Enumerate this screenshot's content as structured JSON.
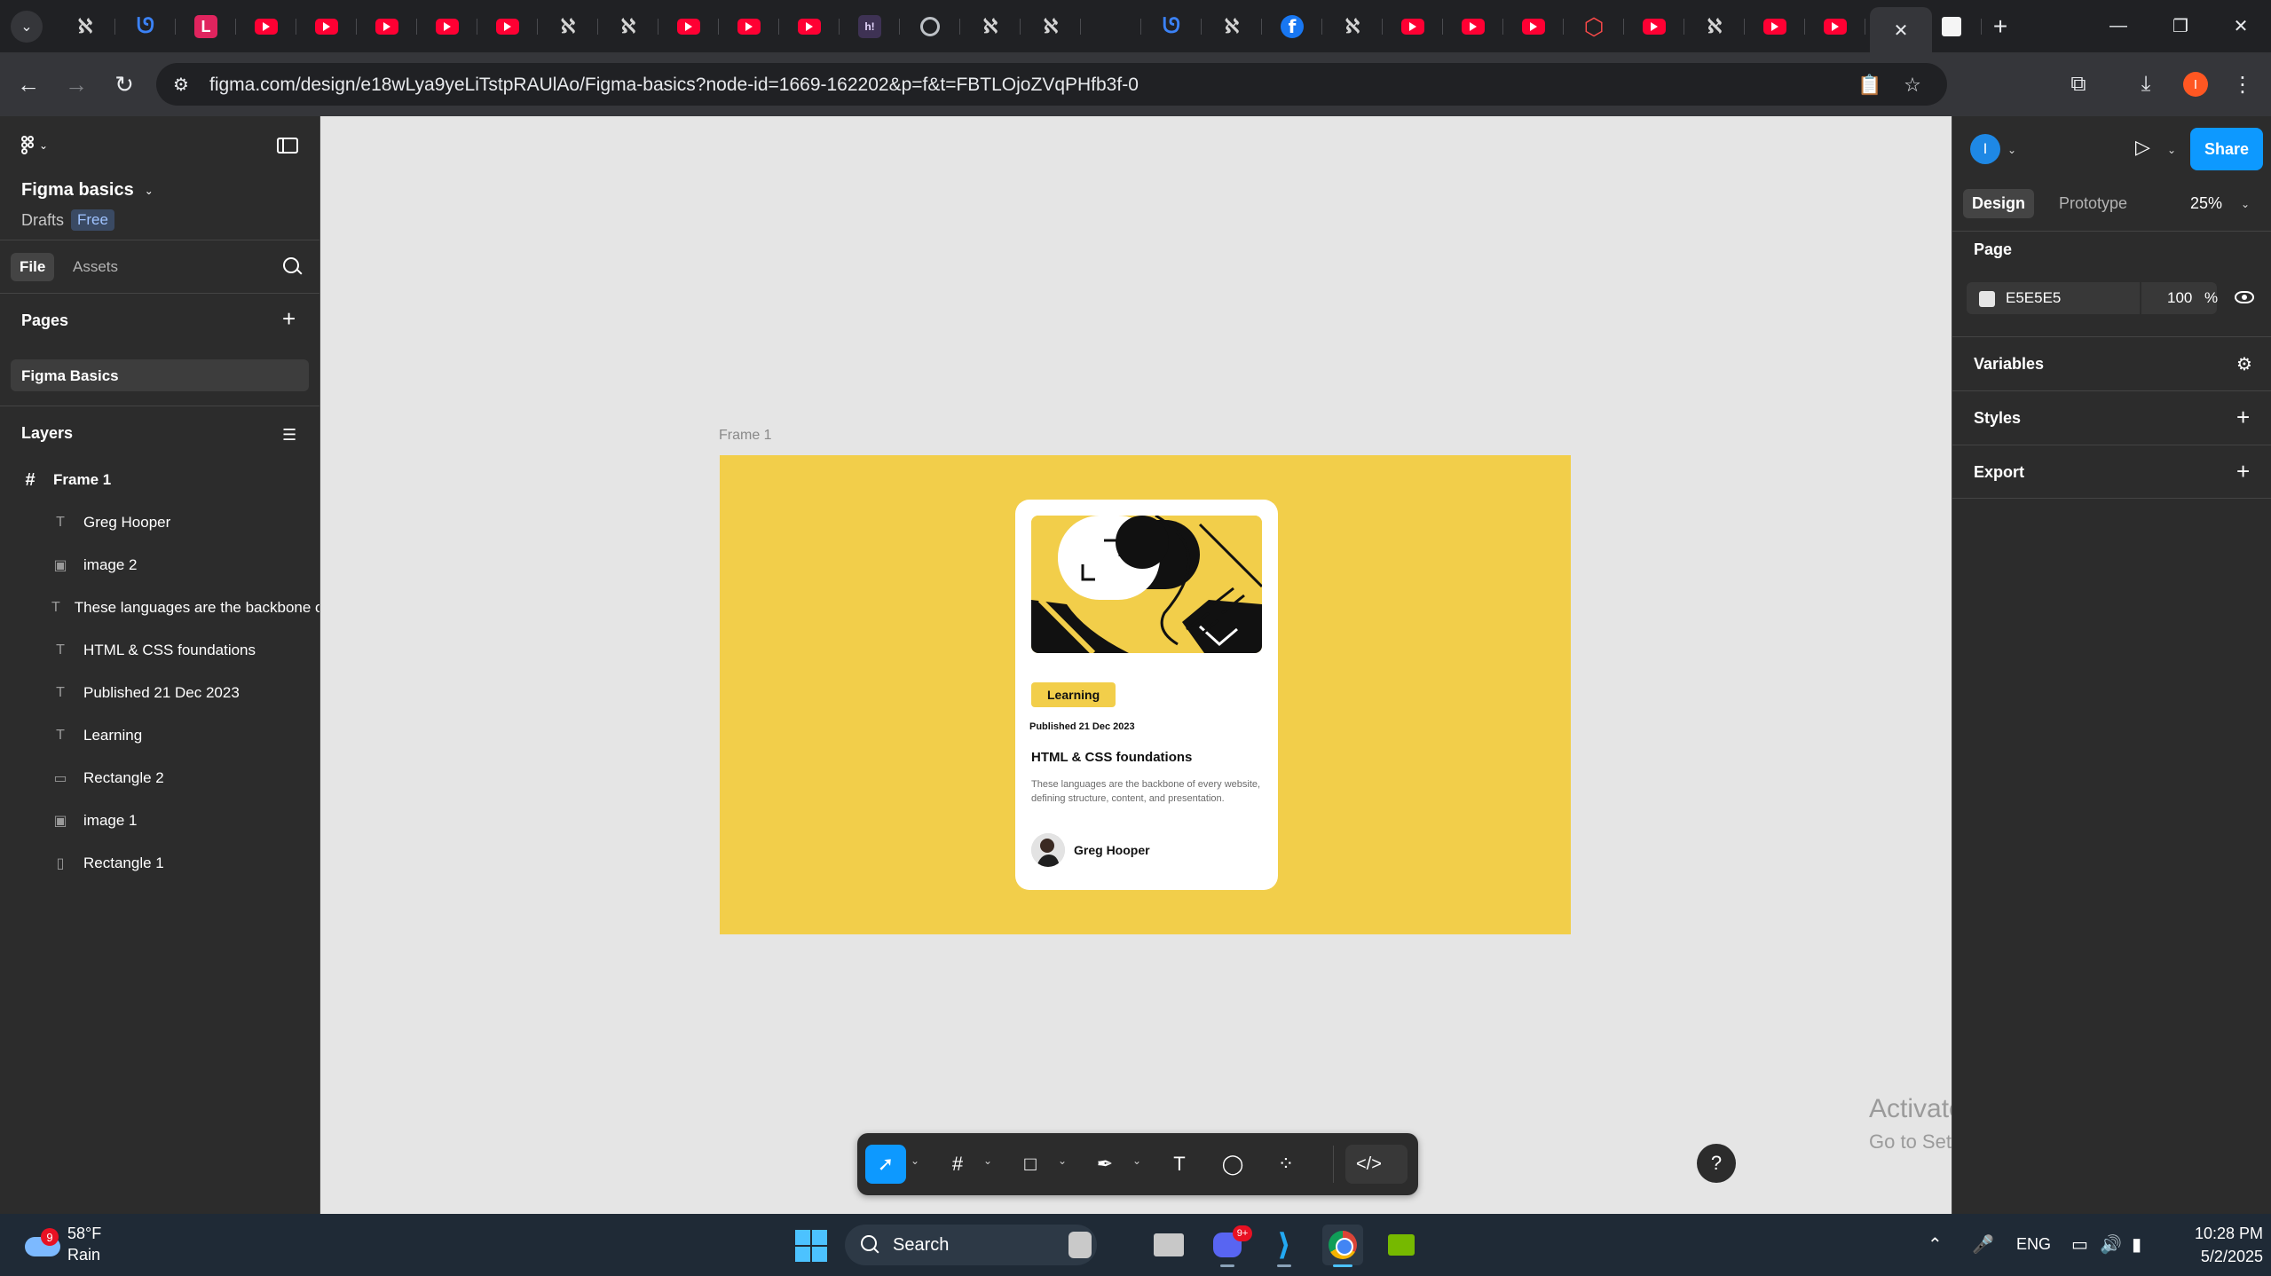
{
  "browser": {
    "url": "figma.com/design/e18wLya9yeLiTstpRAUlAo/Figma-basics?node-id=1669-162202&p=f&t=FBTLOjoZVqPHfb3f-0",
    "profile_initial": "I",
    "tabs": [
      {
        "icon": "lc-icon",
        "glyph": "ℵ"
      },
      {
        "icon": "blue-app-icon",
        "glyph": "ᘎ"
      },
      {
        "icon": "red-l-icon",
        "glyph": "L"
      },
      {
        "icon": "youtube-icon",
        "glyph": ""
      },
      {
        "icon": "youtube-icon",
        "glyph": ""
      },
      {
        "icon": "youtube-icon",
        "glyph": ""
      },
      {
        "icon": "youtube-icon",
        "glyph": ""
      },
      {
        "icon": "youtube-icon",
        "glyph": ""
      },
      {
        "icon": "lc-icon",
        "glyph": "ℵ"
      },
      {
        "icon": "lc-icon",
        "glyph": "ℵ"
      },
      {
        "icon": "youtube-icon",
        "glyph": ""
      },
      {
        "icon": "youtube-icon",
        "glyph": ""
      },
      {
        "icon": "youtube-icon",
        "glyph": ""
      },
      {
        "icon": "hackerrank-icon",
        "glyph": "h!"
      },
      {
        "icon": "globe-icon",
        "glyph": ""
      },
      {
        "icon": "lc-icon",
        "glyph": "ℵ"
      },
      {
        "icon": "lc-icon",
        "glyph": "ℵ"
      },
      {
        "icon": "blank-icon",
        "glyph": ""
      },
      {
        "icon": "blue-app-icon",
        "glyph": "ᘎ"
      },
      {
        "icon": "lc-icon",
        "glyph": "ℵ"
      },
      {
        "icon": "facebook-icon",
        "glyph": "f"
      },
      {
        "icon": "lc-icon",
        "glyph": "ℵ"
      },
      {
        "icon": "youtube-icon",
        "glyph": ""
      },
      {
        "icon": "youtube-icon",
        "glyph": ""
      },
      {
        "icon": "youtube-icon",
        "glyph": ""
      },
      {
        "icon": "red-hex-icon",
        "glyph": "⬡"
      },
      {
        "icon": "youtube-icon",
        "glyph": ""
      },
      {
        "icon": "lc-icon",
        "glyph": "ℵ"
      },
      {
        "icon": "youtube-icon",
        "glyph": ""
      },
      {
        "icon": "youtube-icon",
        "glyph": ""
      }
    ]
  },
  "figma": {
    "file_name": "Figma basics",
    "location": "Drafts",
    "plan_badge": "Free",
    "left_tabs": [
      "File",
      "Assets"
    ],
    "pages_title": "Pages",
    "pages": [
      "Figma Basics"
    ],
    "layers_title": "Layers",
    "layers": [
      {
        "name": "Frame 1",
        "type": "frame-icon",
        "glyph": "#"
      },
      {
        "name": "Greg Hooper",
        "type": "text-icon",
        "glyph": "T"
      },
      {
        "name": "image 2",
        "type": "image-icon",
        "glyph": "▣"
      },
      {
        "name": "These languages are the backbone of every website, defining structure, content, and presentation.",
        "type": "text-icon",
        "glyph": "T"
      },
      {
        "name": "HTML & CSS foundations",
        "type": "text-icon",
        "glyph": "T"
      },
      {
        "name": "Published 21 Dec 2023",
        "type": "text-icon",
        "glyph": "T"
      },
      {
        "name": "Learning",
        "type": "text-icon",
        "glyph": "T"
      },
      {
        "name": "Rectangle 2",
        "type": "rectangle-icon",
        "glyph": "▭"
      },
      {
        "name": "image 1",
        "type": "image-icon",
        "glyph": "▣"
      },
      {
        "name": "Rectangle 1",
        "type": "rectangle-icon",
        "glyph": "▯"
      }
    ],
    "canvas": {
      "background": "#E5E5E5",
      "frame_label": "Frame 1",
      "frame_color": "#F2CE4A",
      "card": {
        "tag": "Learning",
        "published": "Published 21 Dec 2023",
        "title": "HTML & CSS foundations",
        "body": "These languages are the backbone of every website, defining structure, content, and presentation.",
        "author": "Greg Hooper"
      }
    },
    "right_panel": {
      "avatar_initial": "I",
      "share_label": "Share",
      "tabs": [
        "Design",
        "Prototype"
      ],
      "zoom": "25%",
      "page_title": "Page",
      "page_color_hex": "E5E5E5",
      "page_opacity": "100",
      "percent_sign": "%",
      "sections": [
        "Variables",
        "Styles",
        "Export"
      ]
    },
    "watermark": {
      "title": "Activate Windows",
      "subtitle": "Go to Settings to activate Windows."
    },
    "help_label": "?"
  },
  "taskbar": {
    "weather_badge": "9",
    "temperature": "58°F",
    "condition": "Rain",
    "search_label": "Search",
    "discord_badge": "9+",
    "language": "ENG",
    "time": "10:28 PM",
    "date": "5/2/2025"
  }
}
